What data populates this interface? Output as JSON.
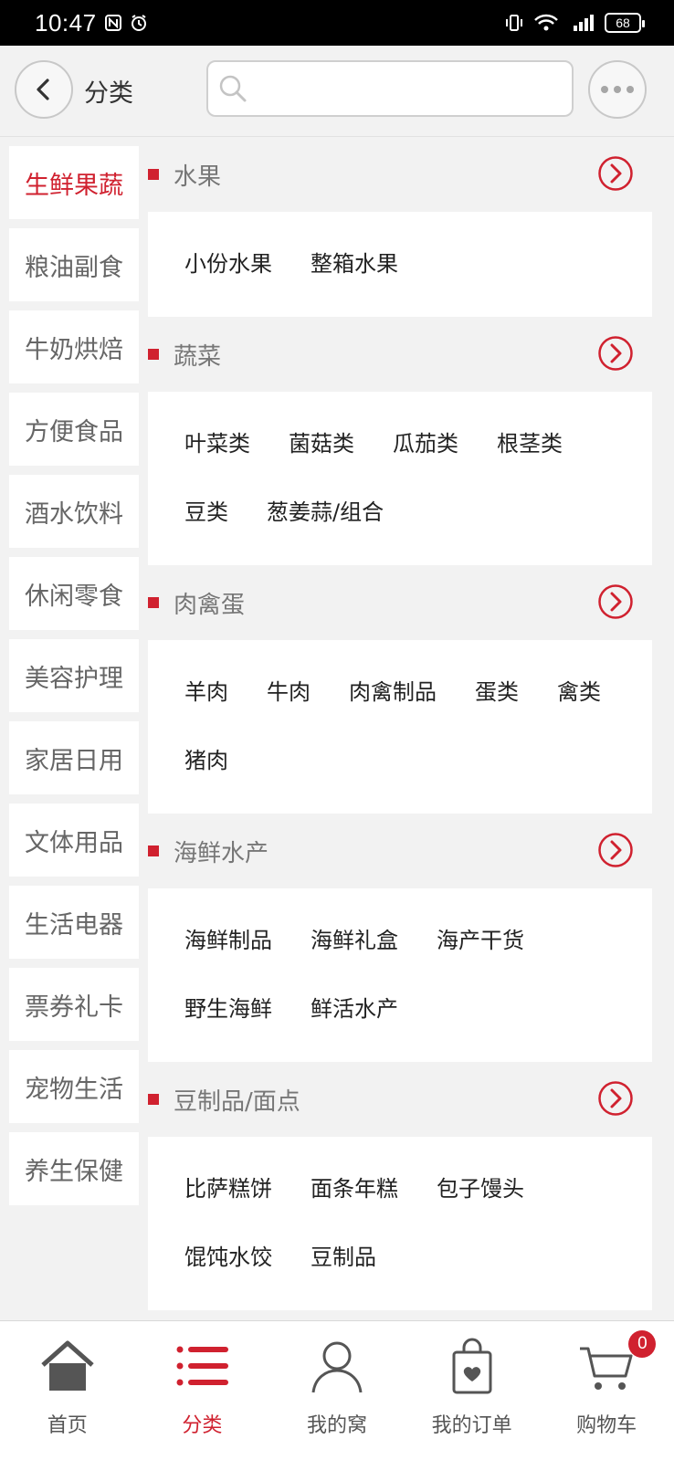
{
  "status_bar": {
    "time": "10:47",
    "battery": "68"
  },
  "header": {
    "title": "分类",
    "search": {
      "value": "",
      "placeholder": ""
    }
  },
  "sidebar": {
    "items": [
      {
        "label": "生鲜果蔬",
        "active": true
      },
      {
        "label": "粮油副食"
      },
      {
        "label": "牛奶烘焙"
      },
      {
        "label": "方便食品"
      },
      {
        "label": "酒水饮料"
      },
      {
        "label": "休闲零食"
      },
      {
        "label": "美容护理"
      },
      {
        "label": "家居日用"
      },
      {
        "label": "文体用品"
      },
      {
        "label": "生活电器"
      },
      {
        "label": "票券礼卡"
      },
      {
        "label": "宠物生活"
      },
      {
        "label": "养生保健"
      }
    ]
  },
  "sections": [
    {
      "title": "水果",
      "items": [
        "小份水果",
        "整箱水果"
      ]
    },
    {
      "title": "蔬菜",
      "items": [
        "叶菜类",
        "菌菇类",
        "瓜茄类",
        "根茎类",
        "豆类",
        "葱姜蒜/组合"
      ]
    },
    {
      "title": "肉禽蛋",
      "items": [
        "羊肉",
        "牛肉",
        "肉禽制品",
        "蛋类",
        "禽类",
        "猪肉"
      ]
    },
    {
      "title": "海鲜水产",
      "items": [
        "海鲜制品",
        "海鲜礼盒",
        "海产干货",
        "野生海鲜",
        "鲜活水产"
      ]
    },
    {
      "title": "豆制品/面点",
      "items": [
        "比萨糕饼",
        "面条年糕",
        "包子馒头",
        "馄饨水饺",
        "豆制品"
      ]
    }
  ],
  "tabbar": {
    "tabs": [
      {
        "label": "首页",
        "icon": "home-icon"
      },
      {
        "label": "分类",
        "icon": "category-list-icon",
        "active": true
      },
      {
        "label": "我的窝",
        "icon": "user-icon"
      },
      {
        "label": "我的订单",
        "icon": "order-bag-icon"
      },
      {
        "label": "购物车",
        "icon": "cart-icon",
        "badge": "0"
      }
    ]
  },
  "colors": {
    "accent": "#d0212f",
    "background": "#f2f2f2"
  }
}
